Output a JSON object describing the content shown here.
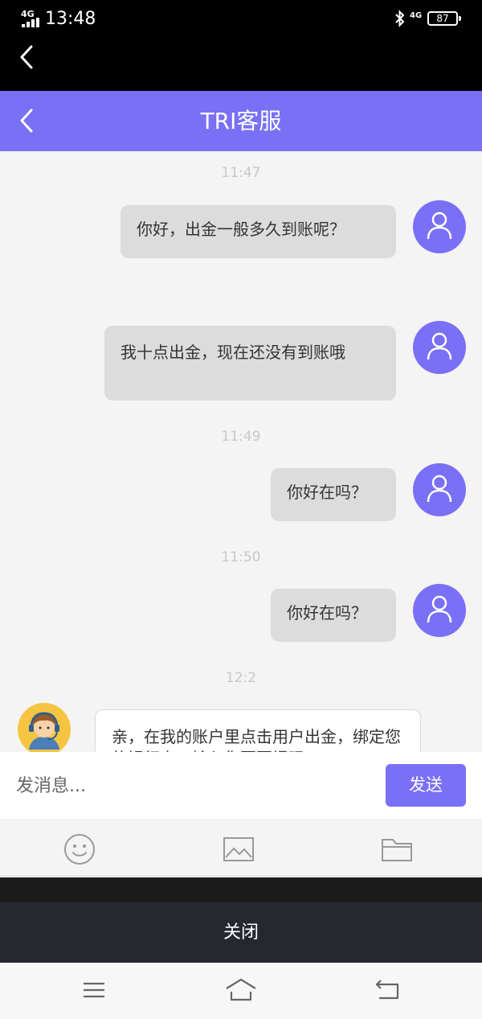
{
  "status_bar": {
    "network": "4G",
    "time": "13:48",
    "network_right": "4G",
    "battery": "87"
  },
  "header": {
    "title": "TRI客服"
  },
  "messages": [
    {
      "timestamp": "11:47"
    },
    {
      "text": "你好，出金一般多久到账呢？"
    },
    {
      "text": "我十点出金，现在还没有到账哦"
    },
    {
      "timestamp": "11:49"
    },
    {
      "text": "你好在吗？"
    },
    {
      "timestamp": "11:50"
    },
    {
      "text": "你好在吗？"
    },
    {
      "timestamp": "12:2"
    },
    {
      "text": "亲，在我的账户里点击用户出金，绑定您的银行卡，输入您要要提现"
    }
  ],
  "composer": {
    "placeholder": "发消息...",
    "send_label": "发送"
  },
  "toolbar": {
    "icons": [
      "emoji-icon",
      "image-icon",
      "folder-icon"
    ]
  },
  "close_label": "关闭",
  "colors": {
    "accent": "#7a70f5",
    "bubble_sent": "#dcdcdc",
    "background": "#f4f4f4"
  }
}
